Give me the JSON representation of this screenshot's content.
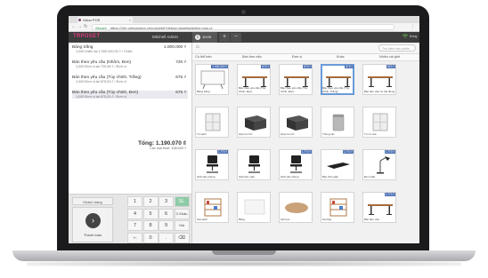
{
  "browser": {
    "tab_title": "Odoo POS",
    "tab_close": "×",
    "secure_label": "Secure",
    "url": "https://10e.ui/evolution.vn/pos/web?debug=assets#action=pos.ui",
    "back": "←",
    "forward": "→",
    "reload": "↻",
    "menu": "⋮"
  },
  "pos_header": {
    "logo": "TRPOSET",
    "logo_suffix": "",
    "cashier": "Mitchell Admin",
    "order_number": "2",
    "order_time": "10:09",
    "add_order": "+",
    "remove_order": "−",
    "close_label": "Đóng"
  },
  "order_lines": [
    {
      "name": "Bảng trắng",
      "detail": "1,000 chiếc tại 1.000.000,00 ₫ / Chiếc",
      "price": "1.000.000 ₫"
    },
    {
      "name": "Bàn theo yêu cầu (Nhôm, Đen)",
      "detail": "1,000 Đơn vị tại 720,56 ₫ / Đơn vị",
      "price": "720 ₫"
    },
    {
      "name": "Bàn theo yêu cầu (Tùy chỉnh, Trắng)",
      "detail": "1,000 Đơn vị tại 675,00 ₫ / Đơn vị",
      "price": "675 ₫"
    },
    {
      "name": "Bàn theo yêu cầu (Tùy chỉnh, Đen)",
      "detail": "1,000 Đơn vị tại 675,00 ₫ / Đơn vị",
      "price": "675 ₫"
    }
  ],
  "totals": {
    "total": "Tổng: 1.190.070 ₫",
    "tax": "Các loại thuế: 108.000 ₫"
  },
  "pad": {
    "customer": "Khách hàng",
    "payment": "Thanh toán",
    "payment_icon": "›",
    "keys": [
      "1",
      "2",
      "3",
      "SL",
      "4",
      "5",
      "6",
      "C.Khấu",
      "7",
      "8",
      "9",
      "Giá",
      "+/-",
      "0",
      ".",
      "⌫"
    ]
  },
  "catalog": {
    "search_placeholder": "Tìm kiếm sản phẩm",
    "home_icon": "⌂",
    "categories": [
      "Có thể bán",
      "Bàn làm việc",
      "Đơn vị",
      "Khác",
      "Nhiều cái ghế"
    ],
    "products": [
      {
        "name": "Bảng trắng",
        "price": "1.000.000 ₫",
        "img": "whiteboard"
      },
      {
        "name": "Bàn theo yêu cầu (Tùy chỉnh, Đen)",
        "price": "675 ₫",
        "img": "desk"
      },
      {
        "name": "Bàn theo yêu cầu (Tùy chỉnh, Đen)",
        "price": "675 ₫",
        "img": "desk"
      },
      {
        "name": "Bàn theo yêu cầu (Tùy chỉnh, Trắng)",
        "price": "675 ₫",
        "img": "desk",
        "selected": true
      },
      {
        "name": "Bàn làm việc có thể đứng",
        "price": "820 ₫",
        "img": "desk"
      },
      {
        "name": "Tủ sách",
        "price": "",
        "img": "cabinet"
      },
      {
        "name": "Hộp lưu trữ",
        "price": "",
        "img": "box"
      },
      {
        "name": "Hộp lưu trữ",
        "price": "",
        "img": "box"
      },
      {
        "name": "Thùng rác",
        "price": "",
        "img": "bin"
      },
      {
        "name": "Tủ có cửa",
        "price": "",
        "img": "cabinet"
      },
      {
        "name": "Ghế văn phòng",
        "price": "1.770 ₫",
        "img": "chair"
      },
      {
        "name": "Ghế tiện nghi",
        "price": "",
        "img": "chair"
      },
      {
        "name": "Ghế văn phòng",
        "price": "1.770 ₫",
        "img": "chair"
      },
      {
        "name": "Bàn đơn giản",
        "price": "1.770 ₫",
        "img": "panel"
      },
      {
        "name": "Đèn LED",
        "price": "1.770 ₫",
        "img": "lamp"
      },
      {
        "name": "Giá sách",
        "price": "",
        "img": "shelf"
      },
      {
        "name": "Bảng",
        "price": "",
        "img": "board"
      },
      {
        "name": "Gối tựa",
        "price": "",
        "img": "pillow"
      },
      {
        "name": "Kệ thép",
        "price": "",
        "img": "shelf"
      },
      {
        "name": "Bàn làm việc",
        "price": "1.770 ₫",
        "img": "desk"
      }
    ]
  }
}
